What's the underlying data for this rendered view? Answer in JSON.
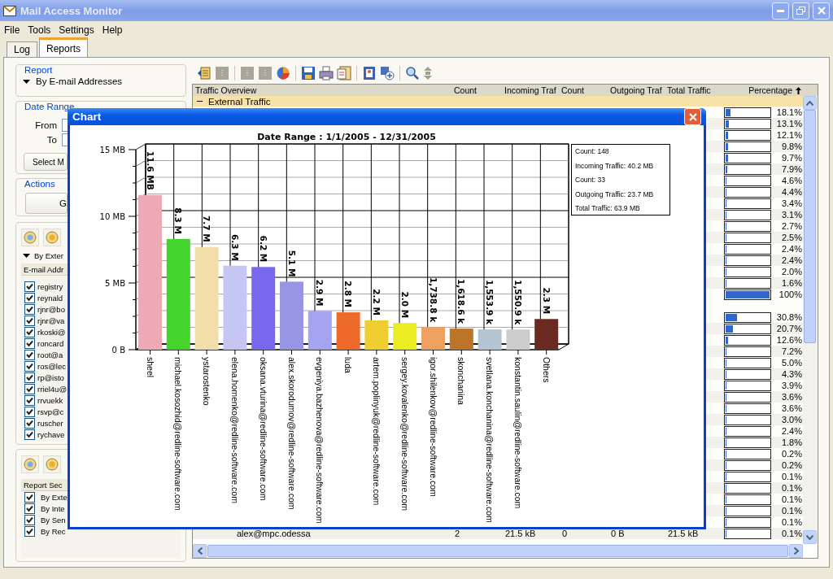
{
  "window": {
    "title": "Mail Access Monitor"
  },
  "menu": [
    "File",
    "Tools",
    "Settings",
    "Help"
  ],
  "tabs": [
    {
      "label": "Log",
      "selected": false
    },
    {
      "label": "Reports",
      "selected": true
    }
  ],
  "report": {
    "legend": "Report",
    "value": "By E-mail Addresses"
  },
  "date_range": {
    "legend": "Date Range",
    "from_label": "From",
    "to_label": "To",
    "select_button": "Select M"
  },
  "actions": {
    "legend": "Actions",
    "button": "G"
  },
  "filter": {
    "group": "By Exter",
    "header": "E-mail Addr",
    "items": [
      {
        "label": "registry",
        "checked": true
      },
      {
        "label": "reynald",
        "checked": true
      },
      {
        "label": "rjnr@bo",
        "checked": true
      },
      {
        "label": "rjnr@va",
        "checked": true
      },
      {
        "label": "rkoski@",
        "checked": true
      },
      {
        "label": "roncard",
        "checked": true
      },
      {
        "label": "root@a",
        "checked": true
      },
      {
        "label": "ros@lec",
        "checked": true
      },
      {
        "label": "rp@isto",
        "checked": true
      },
      {
        "label": "rriel4u@",
        "checked": true
      },
      {
        "label": "rrvuekk",
        "checked": true
      },
      {
        "label": "rsvp@c",
        "checked": true
      },
      {
        "label": "ruscher",
        "checked": true
      },
      {
        "label": "rychave",
        "checked": true
      }
    ]
  },
  "sections": {
    "header": "Report Sec",
    "items": [
      {
        "label": "By Exte",
        "checked": true
      },
      {
        "label": "By Inte",
        "checked": true
      },
      {
        "label": "By Sen",
        "checked": true
      },
      {
        "label": "By Rec",
        "checked": true
      }
    ]
  },
  "table": {
    "columns": [
      "Traffic Overview",
      "Count",
      "Incoming Traf",
      "Count",
      "Outgoing Traf",
      "Total Traffic",
      "Percentage"
    ],
    "group": {
      "label": "External Traffic",
      "expanded": true
    },
    "blocks": [
      {
        "rows": [
          {
            "percentage": "18.1%",
            "level": 0.11
          },
          {
            "percentage": "13.1%",
            "level": 0.08
          },
          {
            "percentage": "12.1%",
            "level": 0.06
          },
          {
            "percentage": "9.8%",
            "level": 0.05
          },
          {
            "percentage": "9.7%",
            "level": 0.05
          },
          {
            "percentage": "7.9%",
            "level": 0.03
          },
          {
            "percentage": "4.6%",
            "level": 0
          },
          {
            "percentage": "4.4%",
            "level": 0
          },
          {
            "percentage": "3.4%",
            "level": 0
          },
          {
            "percentage": "3.1%",
            "level": 0
          },
          {
            "percentage": "2.7%",
            "level": 0
          },
          {
            "percentage": "2.5%",
            "level": 0
          },
          {
            "percentage": "2.4%",
            "level": 0
          },
          {
            "percentage": "2.4%",
            "level": 0
          },
          {
            "percentage": "2.0%",
            "level": 0
          },
          {
            "percentage": "1.6%",
            "level": 0
          },
          {
            "percentage": "100%",
            "level": 1
          }
        ]
      },
      {
        "rows": [
          {
            "percentage": "30.8%",
            "level": 0.25
          },
          {
            "percentage": "20.7%",
            "level": 0.16
          },
          {
            "percentage": "12.6%",
            "level": 0.06
          },
          {
            "percentage": "7.2%",
            "level": 0.02
          },
          {
            "percentage": "5.0%",
            "level": 0
          },
          {
            "percentage": "4.3%",
            "level": 0
          },
          {
            "percentage": "3.9%",
            "level": 0
          },
          {
            "percentage": "3.6%",
            "level": 0
          },
          {
            "percentage": "3.6%",
            "level": 0
          },
          {
            "percentage": "3.0%",
            "level": 0
          },
          {
            "percentage": "2.4%",
            "level": 0
          },
          {
            "percentage": "1.8%",
            "level": 0
          },
          {
            "percentage": "0.2%",
            "level": 0
          },
          {
            "percentage": "0.2%",
            "level": 0
          },
          {
            "percentage": "0.1%",
            "level": 0
          },
          {
            "percentage": "0.1%",
            "level": 0
          },
          {
            "percentage": "0.1%",
            "level": 0
          },
          {
            "percentage": "0.1%",
            "level": 0
          },
          {
            "percentage": "0.1%",
            "level": 0
          }
        ]
      }
    ],
    "last_row": {
      "cells": [
        "alex@mpc.odessa",
        "2",
        "21.5 kB",
        "0",
        "0 B",
        "21.5 kB"
      ],
      "percentage": "0.1%",
      "level": 0
    }
  },
  "chart_window": {
    "title": "Chart",
    "chart_data": {
      "type": "bar",
      "title": "Date Range : 1/1/2005 - 12/31/2005",
      "categories": [
        "sheel",
        "michael.kosozhid@redline-software.com",
        "ystarostenko",
        "elena.homenko@redline-software.com",
        "oksana.vturina@redline-software.com",
        "alex.skorodumov@redline-software.com",
        "evgeniya.bazhenova@redline-software.com",
        "luda",
        "artem.poplinyuk@redline-software.com",
        "sergey.kovalenko@redline-software.com",
        "igor.shilenkov@redline-software.com",
        "skonchanina",
        "svetlana.konchanina@redline-software.com",
        "konstantin.saulin@redline-software.com",
        "Others"
      ],
      "series": [
        {
          "values": [
            11.6,
            8.3,
            7.7,
            6.3,
            6.2,
            5.1,
            2.9,
            2.8,
            2.2,
            2.0,
            1.7,
            1.58,
            1.52,
            1.51,
            2.3
          ]
        }
      ],
      "value_labels": [
        "11.6 MB",
        "8.3 M",
        "7.7 M",
        "6.3 M",
        "6.2 M",
        "5.1 M",
        "2.9 M",
        "2.8 M",
        "2.2 M",
        "2.0 M",
        "1,738.8 k",
        "1,618.6 k",
        "1,553.9 k",
        "1,550.9 k",
        "2.3 M"
      ],
      "ylim": [
        0,
        15
      ],
      "yticks": [
        {
          "value": 0,
          "label": "0 B"
        },
        {
          "value": 5,
          "label": "5 MB"
        },
        {
          "value": 10,
          "label": "10 MB"
        },
        {
          "value": 15,
          "label": "15 MB"
        }
      ]
    },
    "bar_styles": [
      {
        "color": "#eeaab4"
      },
      {
        "color": "#44d42c"
      },
      {
        "color": "#f2dea8"
      },
      {
        "color": "#c6c6f2"
      },
      {
        "color": "#7868ee"
      },
      {
        "color": "#9696e4"
      },
      {
        "color": "#a4a4f0"
      },
      {
        "color": "#ee6a2a"
      },
      {
        "color": "#eece30"
      },
      {
        "color": "#ecec22"
      },
      {
        "color": "#eea060"
      },
      {
        "color": "#bc7428"
      },
      {
        "color": "#b4c4d0"
      },
      {
        "color": "#cccccc"
      },
      {
        "color": "#6a2a20"
      }
    ],
    "summary": [
      "Count: 148",
      "Incoming Traffic: 40.2 MB",
      "Count: 33",
      "Outgoing Traffic: 23.7 MB",
      "Total Traffic: 63.9 MB"
    ]
  }
}
